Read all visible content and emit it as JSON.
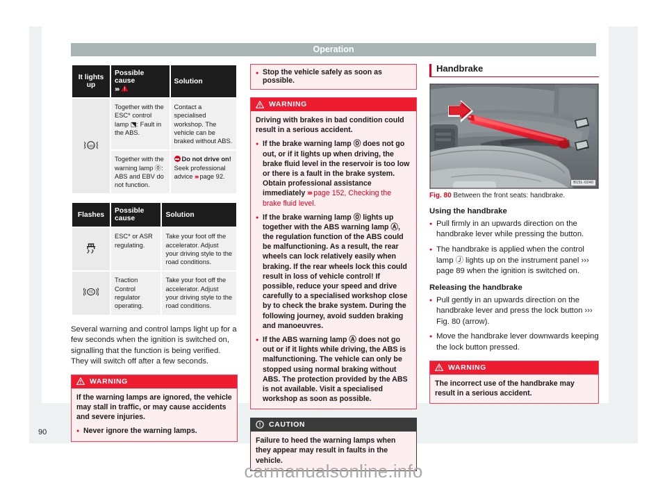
{
  "header": {
    "title": "Operation"
  },
  "footer": {
    "page_number": "90",
    "watermark": "carmanualsonline.info"
  },
  "table_lights": {
    "headers": {
      "col1": "It lights up",
      "col2": "Possible cause",
      "col2_suffix": "›››",
      "col3": "Solution"
    },
    "rows": [
      {
        "icon": "abs-warning-lamp-icon",
        "cause": "Together with the ESC* control lamp ⬔: Fault in the ABS.",
        "solution": "Contact a specialised workshop. The vehicle can be braked without ABS."
      },
      {
        "icon": "abs-warning-lamp-icon",
        "cause": "Together with the warning lamp ⓪: ABS and EBV do not function.",
        "solution_strong": "Do not drive on!",
        "solution": "Seek professional advice",
        "solution_ref": "page 92."
      }
    ]
  },
  "table_flashes": {
    "headers": {
      "col1": "Flashes",
      "col2": "Possible cause",
      "col3": "Solution"
    },
    "rows": [
      {
        "icon": "esc-asr-skid-lamp-icon",
        "cause": "ESC* or ASR regulating.",
        "solution": "Take your foot off the accelerator. Adjust your driving style to the road conditions."
      },
      {
        "icon": "traction-control-lamp-icon",
        "cause": "Traction Control regulator operating.",
        "solution": "Take your foot off the accelerator. Adjust your driving style to the road conditions."
      }
    ]
  },
  "col1_paragraph": "Several warning and control lamps light up for a few seconds when the ignition is switched on, signalling that the function is being verified. They will switch off after a few seconds.",
  "warning_col1": {
    "label": "WARNING",
    "text": "If the warning lamps are ignored, the vehicle may stall in traffic, or may cause accidents and severe injuries.",
    "bullet": "Never ignore the warning lamps."
  },
  "col2_top_bullet": "Stop the vehicle safely as soon as possible.",
  "warning_col2": {
    "label": "WARNING",
    "intro": "Driving with brakes in bad condition could result in a serious accident.",
    "bullet1_a": "If the brake warning lamp ",
    "bullet1_lamp": "⓪",
    "bullet1_b": " does not go out, or if it lights up when driving, the brake fluid level in the reservoir is too low or there is a fault in the brake system. Obtain professional assistance immediately ",
    "bullet1_ref": "page 152, Checking the brake fluid level.",
    "bullet2_a": "If the brake warning lamp ",
    "bullet2_lamp1": "⓪",
    "bullet2_b": " lights up together with the ABS warning lamp ",
    "bullet2_lamp2": "Ⓐ",
    "bullet2_c": ", the regulation function of the ABS could be malfunctioning. As a result, the rear wheels can lock relatively easily when braking. If the rear wheels lock this could result in loss of vehicle control! If possible, reduce your speed and drive carefully to a specialised workshop close by to check the brake system. During the following journey, avoid sudden braking and manoeuvres.",
    "bullet3_a": "If the ABS warning lamp ",
    "bullet3_lamp": "Ⓐ",
    "bullet3_b": " does not go out or if it lights while driving, the ABS is malfunctioning. The vehicle can only be stopped using normal braking without ABS. The protection provided by the ABS is not available. Visit a specialised workshop as soon as possible."
  },
  "caution_col2": {
    "label": "CAUTION",
    "text": "Failure to heed the warning lamps when they appear may result in faults in the vehicle."
  },
  "handbrake": {
    "section_title": "Handbrake",
    "figure": {
      "number": "Fig. 80",
      "caption": "Between the front seats: handbrake.",
      "image_code": "B15L-0240"
    },
    "using_title": "Using the handbrake",
    "using_bullets": [
      "Pull firmly in an upwards direction on the handbrake lever while pressing the button.",
      "The handbrake is applied when the control lamp Ⓙ lights up on the instrument panel ››› page 89 when the ignition is switched on."
    ],
    "releasing_title": "Releasing the handbrake",
    "releasing_bullets": [
      "Pull gently in an upwards direction on the handbrake lever and press the lock button ››› Fig. 80 (arrow).",
      "Move the handbrake lever downwards keeping the lock button pressed."
    ],
    "warning": {
      "label": "WARNING",
      "text": "The incorrect use of the handbrake may result in a serious accident."
    }
  },
  "colors": {
    "accent_red": "#e3001b",
    "warning_red": "#ed1c31",
    "warning_bg": "#fdeef0",
    "caution_dark": "#3b3b3b",
    "header_band": "#a7b4b4",
    "table_header": "#1c1c1c"
  }
}
